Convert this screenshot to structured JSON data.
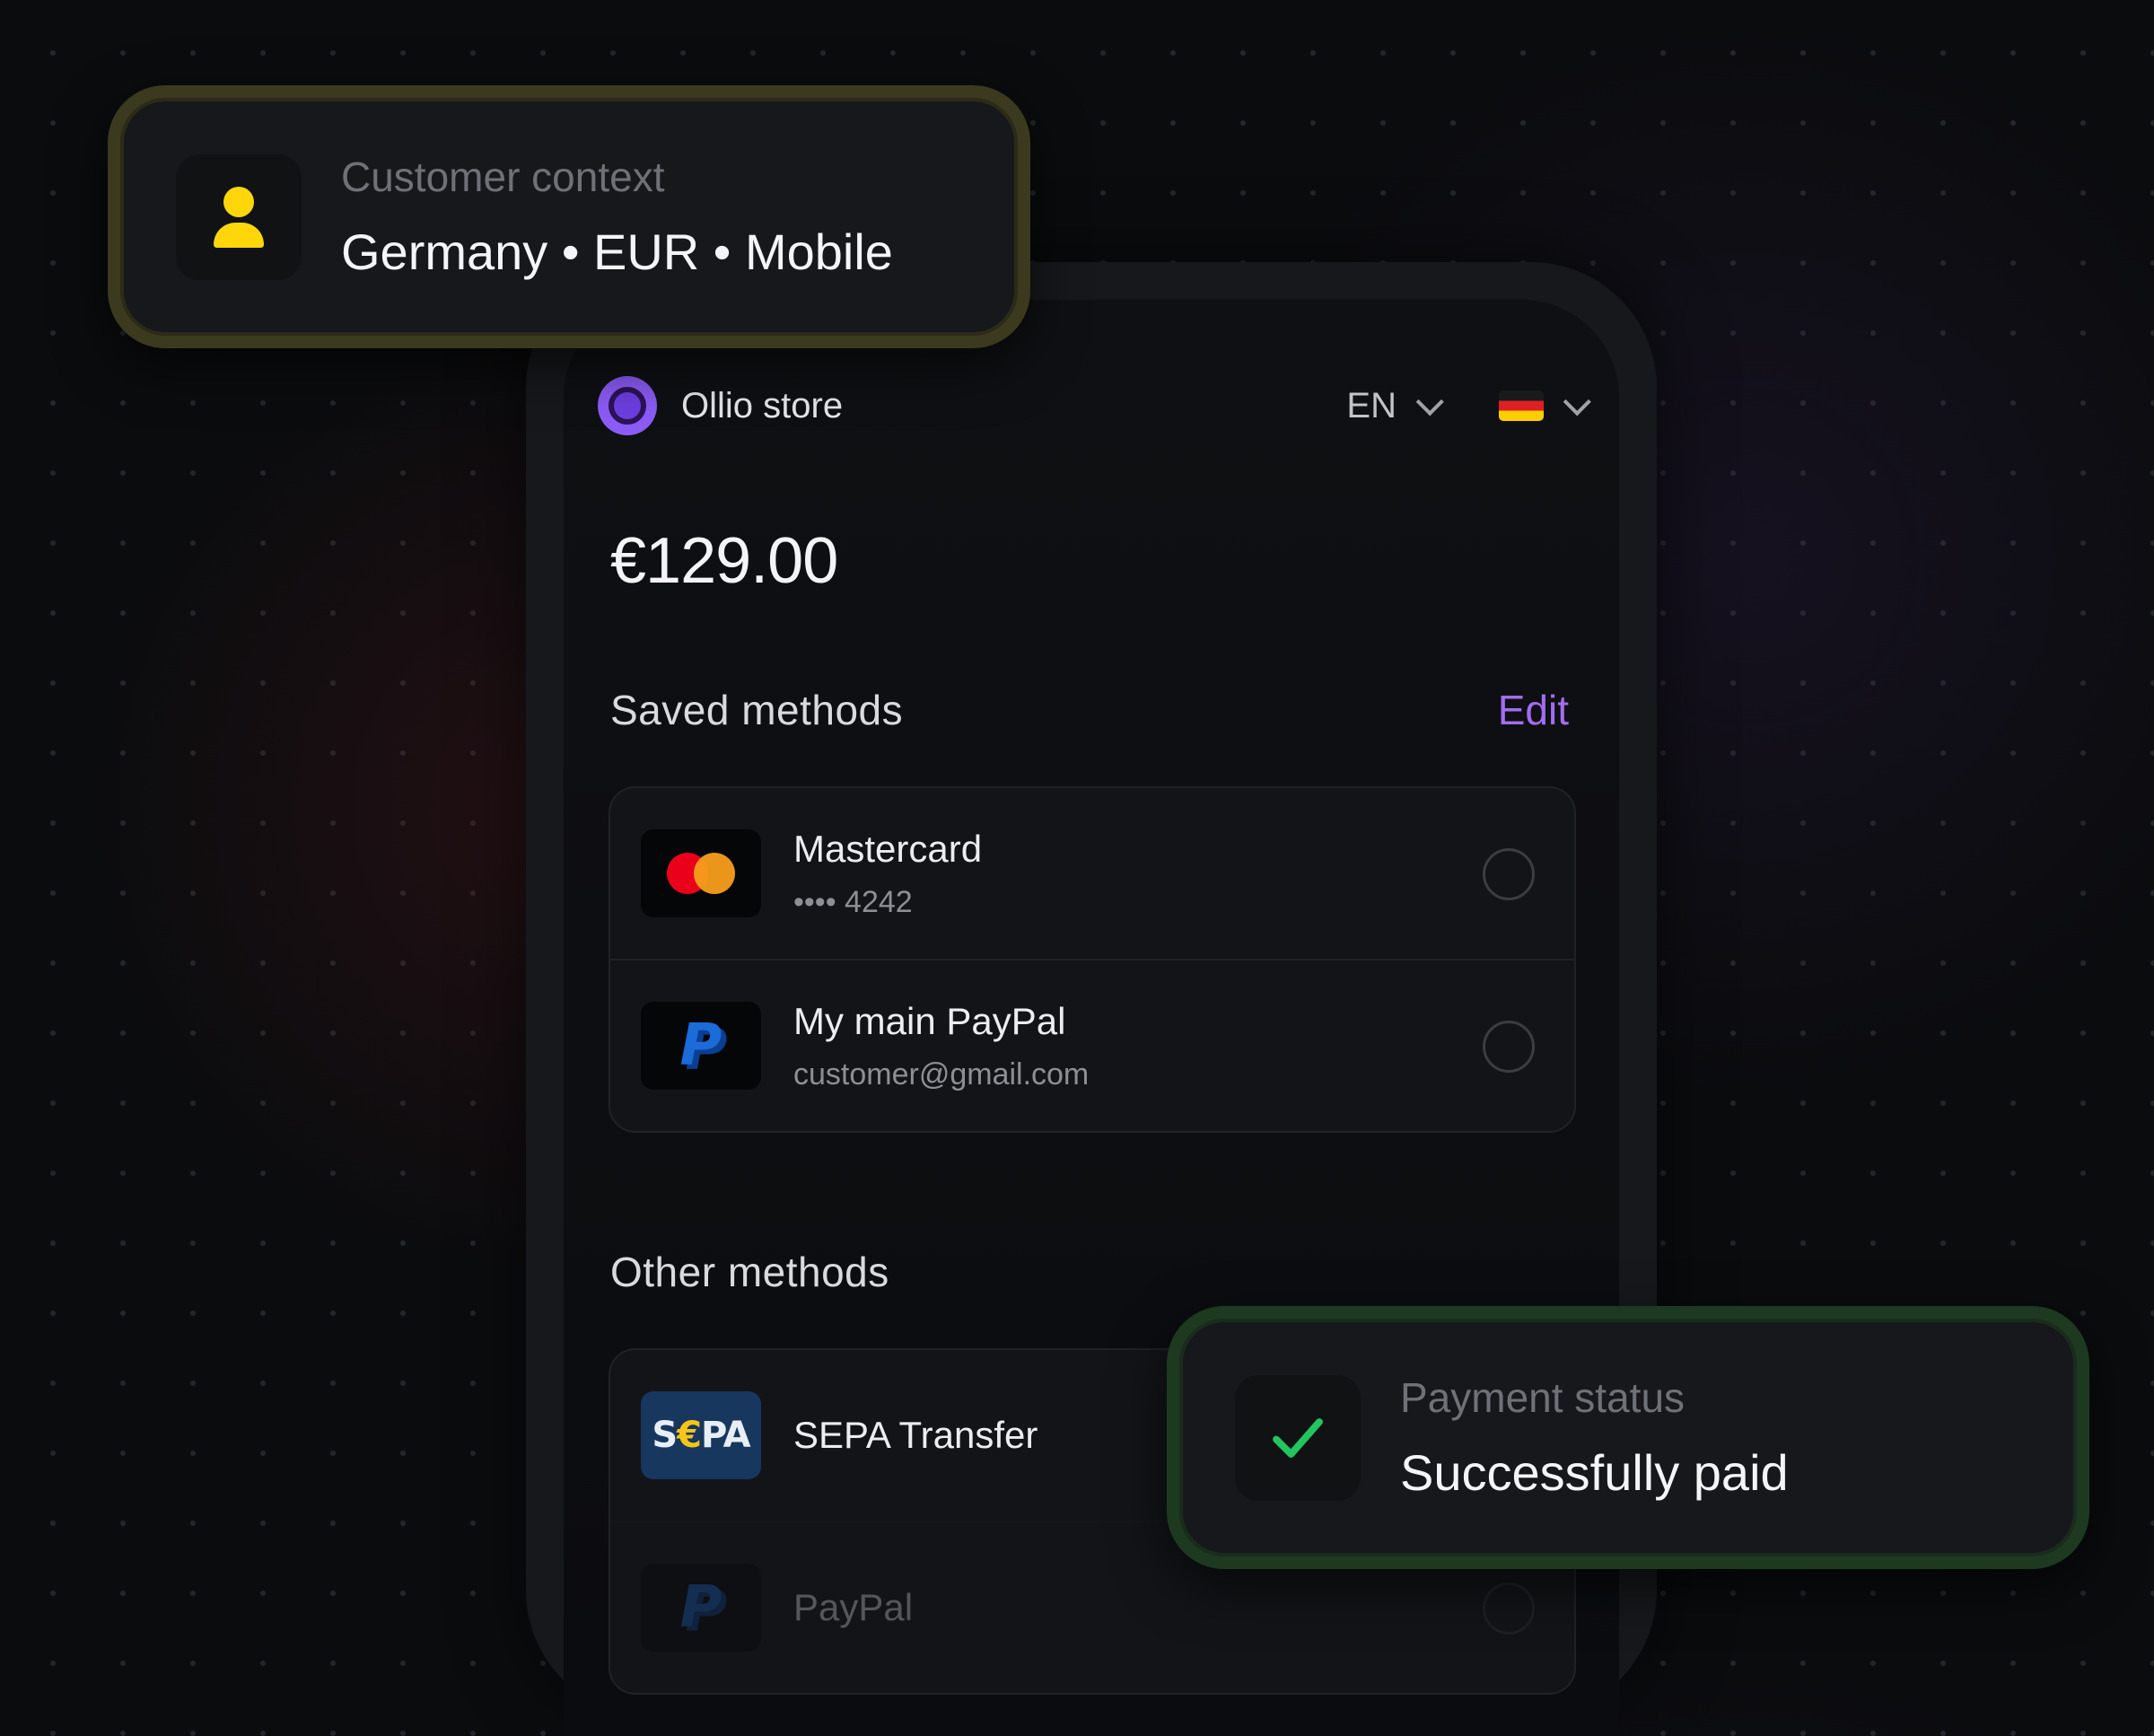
{
  "customer_context": {
    "label": "Customer context",
    "value": "Germany • EUR • Mobile",
    "icon": "user-icon",
    "accent": "#ffd60a"
  },
  "checkout": {
    "store_name": "Ollio store",
    "language": "EN",
    "country_flag": "germany-flag-icon",
    "amount": "€129.00",
    "saved_methods": {
      "title": "Saved methods",
      "edit_label": "Edit",
      "items": [
        {
          "name": "Mastercard",
          "detail": "•••• 4242",
          "icon": "mastercard-icon"
        },
        {
          "name": "My main PayPal",
          "detail": "customer@gmail.com",
          "icon": "paypal-icon"
        }
      ]
    },
    "other_methods": {
      "title": "Other methods",
      "items": [
        {
          "name": "SEPA Transfer",
          "icon": "sepa-icon",
          "badge_text_1": "S",
          "badge_text_2": "€",
          "badge_text_3": "PA"
        },
        {
          "name": "PayPal",
          "icon": "paypal-icon"
        }
      ]
    },
    "accent": "#a26cf3"
  },
  "payment_status": {
    "label": "Payment status",
    "value": "Successfully paid",
    "icon": "check-icon",
    "accent": "#22c55e"
  }
}
